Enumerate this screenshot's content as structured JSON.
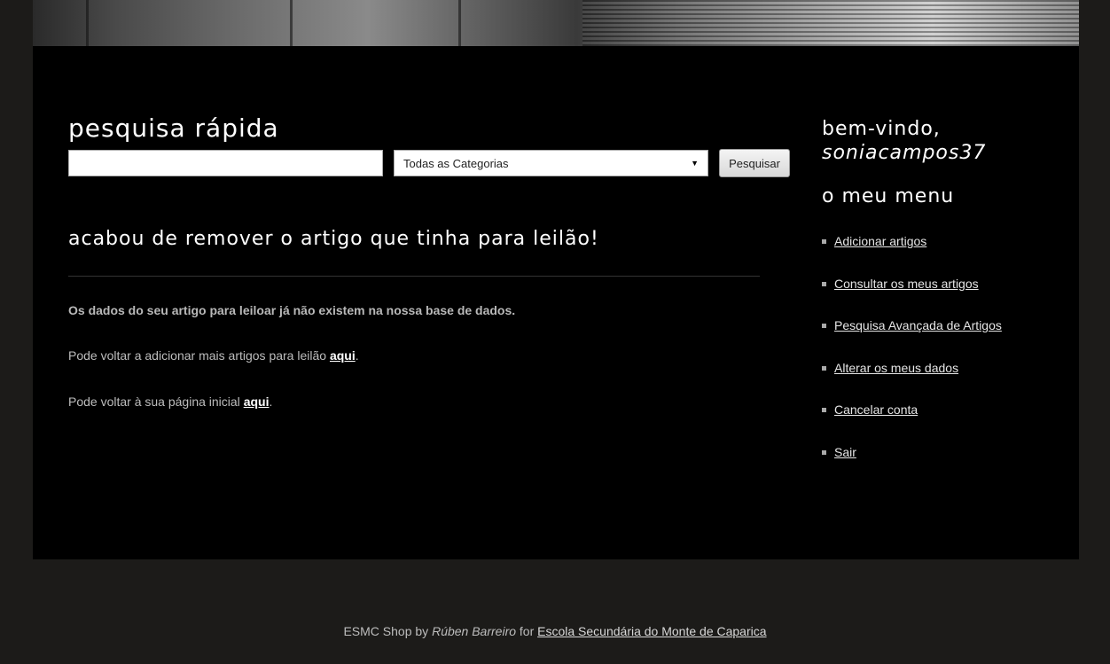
{
  "search": {
    "title": "pesquisa rápida",
    "input_value": "",
    "category_selected": "Todas as Categorias",
    "button_label": "Pesquisar"
  },
  "message": {
    "title": "acabou de remover o artigo que tinha para leilão!",
    "info": "Os dados do seu artigo para leiloar já não existem na nossa base de dados.",
    "line1_text": "Pode voltar a adicionar mais artigos para leilão ",
    "line1_link": "aqui",
    "line1_end": ".",
    "line2_text": "Pode voltar à sua página inicial ",
    "line2_link": "aqui",
    "line2_end": "."
  },
  "sidebar": {
    "welcome": "bem-vindo,",
    "username": "soniacampos37",
    "menu_title": "o meu menu",
    "items": [
      {
        "label": "Adicionar artigos"
      },
      {
        "label": "Consultar os meus artigos"
      },
      {
        "label": "Pesquisa Avançada de Artigos"
      },
      {
        "label": "Alterar os meus dados"
      },
      {
        "label": "Cancelar conta"
      },
      {
        "label": "Sair"
      }
    ]
  },
  "footer": {
    "prefix": "ESMC Shop by ",
    "author": "Rúben Barreiro",
    "middle": " for ",
    "school": "Escola Secundária do Monte de Caparica"
  }
}
